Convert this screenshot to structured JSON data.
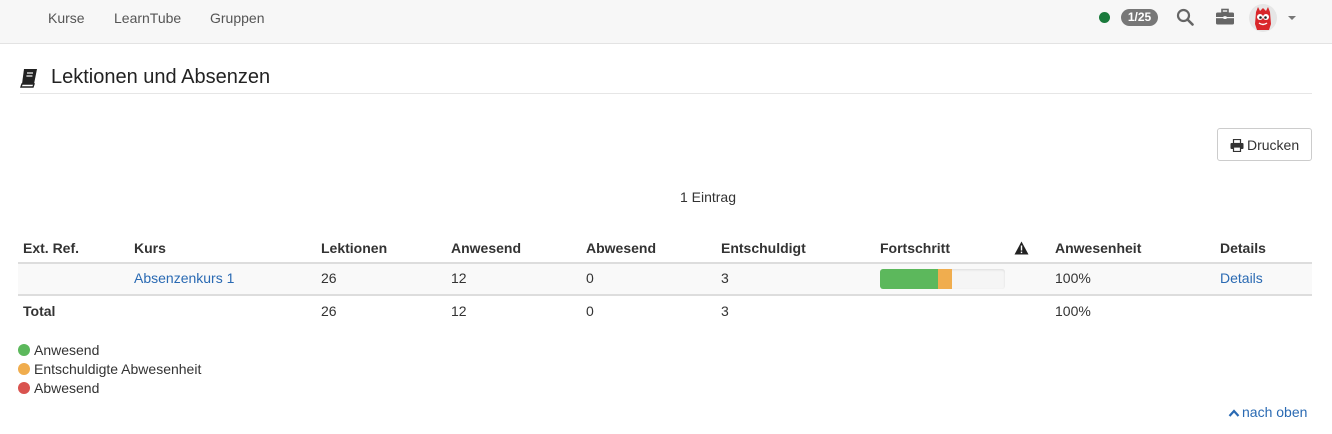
{
  "nav": {
    "items": [
      "Kurse",
      "LearnTube",
      "Gruppen"
    ],
    "status_color": "#1a7a3c",
    "badge": "1/25",
    "icons": [
      "search-icon",
      "briefcase-icon",
      "avatar",
      "caret-down-icon"
    ]
  },
  "page": {
    "title": "Lektionen und Absenzen",
    "title_icon": "book-icon"
  },
  "toolbar": {
    "print_label": "Drucken",
    "print_icon": "print-icon"
  },
  "table": {
    "entry_count": "1 Eintrag",
    "headers": {
      "ext_ref": "Ext. Ref.",
      "course": "Kurs",
      "lessons": "Lektionen",
      "present": "Anwesend",
      "absent": "Abwesend",
      "excused": "Entschuldigt",
      "progress": "Fortschritt",
      "warning_icon": "warning-icon",
      "attendance": "Anwesenheit",
      "details": "Details"
    },
    "rows": [
      {
        "ext_ref": "",
        "course": "Absenzenkurs 1",
        "lessons": "26",
        "present": "12",
        "absent": "0",
        "excused": "3",
        "progress": {
          "present": 12,
          "excused": 3,
          "absent": 0,
          "total": 26
        },
        "attendance": "100%",
        "details": "Details"
      }
    ],
    "total": {
      "label": "Total",
      "lessons": "26",
      "present": "12",
      "absent": "0",
      "excused": "3",
      "attendance": "100%"
    }
  },
  "legend": [
    {
      "label": "Anwesend",
      "color": "#5cb85c"
    },
    {
      "label": "Entschuldigte Abwesenheit",
      "color": "#f0ad4e"
    },
    {
      "label": "Abwesend",
      "color": "#d9534f"
    }
  ],
  "footer": {
    "back_to_top": "nach oben",
    "back_icon": "chevron-up-icon"
  }
}
